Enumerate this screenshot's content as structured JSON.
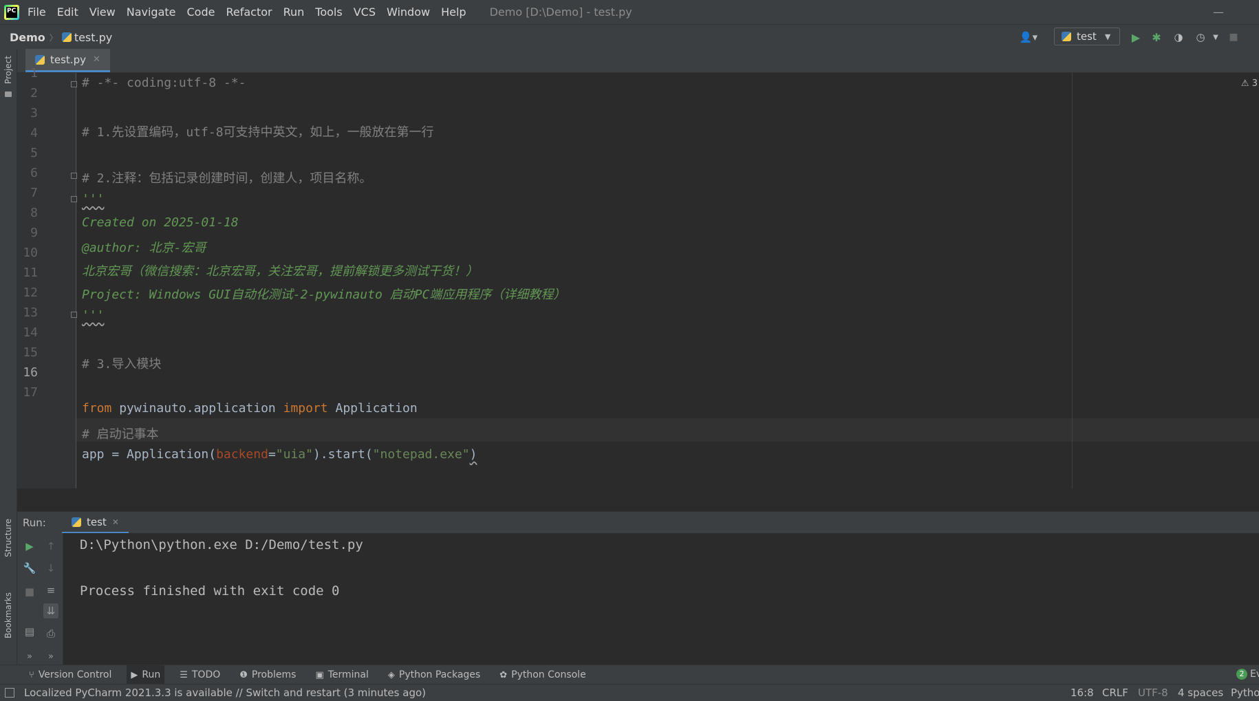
{
  "menubar": {
    "items": [
      "File",
      "Edit",
      "View",
      "Navigate",
      "Code",
      "Refactor",
      "Run",
      "Tools",
      "VCS",
      "Window",
      "Help"
    ],
    "window_title": "Demo [D:\\Demo] - test.py"
  },
  "navbar": {
    "project": "Demo",
    "file": "test.py",
    "run_config": "test"
  },
  "left_strip": {
    "project": "Project",
    "structure": "Structure",
    "bookmarks": "Bookmarks"
  },
  "editor": {
    "tab": "test.py",
    "line_numbers": [
      "1",
      "2",
      "3",
      "4",
      "5",
      "6",
      "7",
      "8",
      "9",
      "10",
      "11",
      "12",
      "13",
      "14",
      "15",
      "16",
      "17"
    ],
    "current_line": "16",
    "warning_count": "3",
    "lines": {
      "l1": "# -*- coding:utf-8 -*-",
      "l3": "# 1.先设置编码，utf-8可支持中英文，如上，一般放在第一行",
      "l5": "# 2.注释：包括记录创建时间，创建人，项目名称。",
      "l6": "'''",
      "l7": "Created on 2025-01-18",
      "l8": "@author: 北京-宏哥",
      "l9": "北京宏哥（微信搜索：北京宏哥，关注宏哥，提前解锁更多测试干货！）",
      "l10": "Project: Windows GUI自动化测试-2-pywinauto 启动PC端应用程序（详细教程）",
      "l11": "'''",
      "l13": "# 3.导入模块",
      "l15_kw1": "from",
      "l15_mod": " pywinauto.application ",
      "l15_kw2": "import",
      "l15_name": " Application",
      "l16": "# 启动记事本",
      "l17_a": "app = Application(",
      "l17_param": "backend",
      "l17_eq": "=",
      "l17_str1": "\"uia\"",
      "l17_b": ").start(",
      "l17_str2": "\"notepad.exe\"",
      "l17_c": ")"
    }
  },
  "run_panel": {
    "label": "Run:",
    "tab": "test",
    "console": {
      "cmd": "D:\\Python\\python.exe D:/Demo/test.py",
      "result": "Process finished with exit code 0"
    }
  },
  "toolwindows": {
    "version_control": "Version Control",
    "run": "Run",
    "todo": "TODO",
    "problems": "Problems",
    "terminal": "Terminal",
    "python_packages": "Python Packages",
    "python_console": "Python Console",
    "event_badge": "2",
    "event_label": "Ev"
  },
  "statusbar": {
    "message": "Localized PyCharm 2021.3.3 is available // Switch and restart (3 minutes ago)",
    "position": "16:8",
    "line_sep": "CRLF",
    "encoding": "UTF-8",
    "indent": "4 spaces",
    "interpreter": "Pytho"
  },
  "colors": {
    "background": "#2b2b2b",
    "panel": "#3c3f41",
    "keyword": "#cc7832",
    "string": "#6a8759",
    "docstring": "#629755",
    "comment": "#808080",
    "accent": "#4a88c7",
    "run_green": "#59a869"
  }
}
